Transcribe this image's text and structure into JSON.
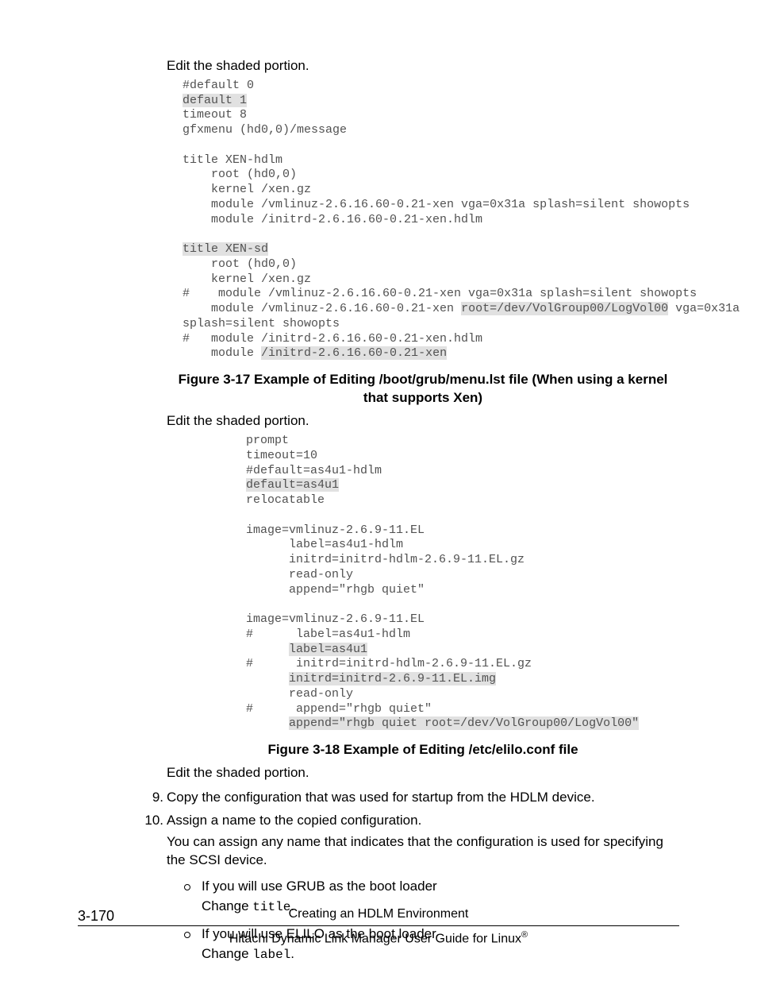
{
  "intro1": "Edit the shaded portion.",
  "code1": {
    "l01": "#default 0",
    "l02": "default 1",
    "l03": "timeout 8",
    "l04": "gfxmenu (hd0,0)/message",
    "l05": "",
    "l06": "title XEN-hdlm",
    "l07": "    root (hd0,0)",
    "l08": "    kernel /xen.gz",
    "l09": "    module /vmlinuz-2.6.16.60-0.21-xen vga=0x31a splash=silent showopts",
    "l10": "    module /initrd-2.6.16.60-0.21-xen.hdlm",
    "l11": "",
    "l12a": "title XEN-sd",
    "l13": "    root (hd0,0)",
    "l14": "    kernel /xen.gz",
    "l15": "#    module /vmlinuz-2.6.16.60-0.21-xen vga=0x31a splash=silent showopts",
    "l16a": "    module /vmlinuz-2.6.16.60-0.21-xen ",
    "l16b": "root=/dev/VolGroup00/LogVol00",
    "l16c": " vga=0x31a",
    "l17": "splash=silent showopts",
    "l18": "#   module /initrd-2.6.16.60-0.21-xen.hdlm",
    "l19a": "    module ",
    "l19b": "/initrd-2.6.16.60-0.21-xen"
  },
  "caption1": "Figure 3-17 Example of Editing /boot/grub/menu.lst file (When using a kernel that supports Xen)",
  "intro2": "Edit the shaded portion.",
  "code2": {
    "l01": "prompt",
    "l02": "timeout=10",
    "l03": "#default=as4u1-hdlm",
    "l04": "default=as4u1",
    "l05": "relocatable",
    "l06": "",
    "l07": "image=vmlinuz-2.6.9-11.EL",
    "l08": "      label=as4u1-hdlm",
    "l09": "      initrd=initrd-hdlm-2.6.9-11.EL.gz",
    "l10": "      read-only",
    "l11": "      append=\"rhgb quiet\"",
    "l12": "",
    "l13": "image=vmlinuz-2.6.9-11.EL",
    "l14": "#      label=as4u1-hdlm",
    "l15a": "      ",
    "l15b": "label=as4u1",
    "l16": "#      initrd=initrd-hdlm-2.6.9-11.EL.gz",
    "l17a": "      ",
    "l17b": "initrd=initrd-2.6.9-11.EL.img",
    "l18": "      read-only",
    "l19": "#      append=\"rhgb quiet\"",
    "l20a": "      ",
    "l20b": "append=\"rhgb quiet root=/dev/VolGroup00/LogVol00\""
  },
  "caption2": "Figure 3-18 Example of Editing /etc/elilo.conf file",
  "intro3": "Edit the shaded portion.",
  "steps": {
    "s9": {
      "num": "9.",
      "text": "Copy the configuration that was used for startup from the HDLM device."
    },
    "s10": {
      "num": "10.",
      "text1": "Assign a name to the copied configuration.",
      "text2": "You can assign any name that indicates that the configuration is used for specifying the SCSI device.",
      "bullets": {
        "b1a": "If you will use GRUB as the boot loader",
        "b1b_pre": "Change ",
        "b1b_code": "title",
        "b1b_post": ".",
        "b2a": "If you will use ELILO as the boot loader",
        "b2b_pre": "Change ",
        "b2b_code": "label",
        "b2b_post": "."
      }
    }
  },
  "footer": {
    "pagenum": "3-170",
    "line1": "Creating an HDLM Environment",
    "line2a": "Hitachi Dynamic Link Manager User Guide for Linux",
    "line2b": "®"
  }
}
